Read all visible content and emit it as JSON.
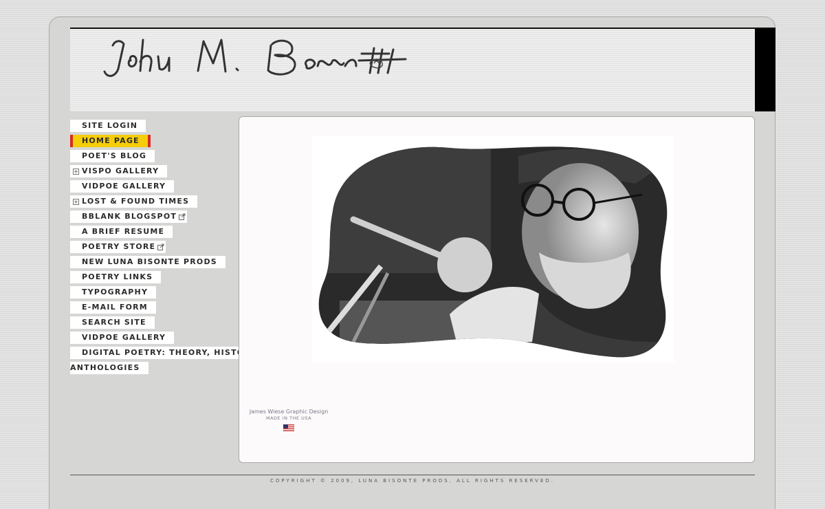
{
  "header": {
    "logo_text": "John M. Bennett"
  },
  "nav": {
    "items": [
      {
        "label": "SITE LOGIN"
      },
      {
        "label": "HOME PAGE"
      },
      {
        "label": "POET'S BLOG"
      },
      {
        "label": "VISPO GALLERY"
      },
      {
        "label": "VIDPOE GALLERY"
      },
      {
        "label": "LOST & FOUND TIMES"
      },
      {
        "label": "BBLANK BLOGSPOT"
      },
      {
        "label": "A BRIEF RESUME"
      },
      {
        "label": "POETRY STORE"
      },
      {
        "label": "NEW LUNA BISONTE PRODS"
      },
      {
        "label": "POETRY LINKS"
      },
      {
        "label": "TYPOGRAPHY"
      },
      {
        "label": "E-MAIL FORM"
      },
      {
        "label": "SEARCH SITE"
      },
      {
        "label": "VIDPOE GALLERY"
      },
      {
        "label": "DIGITAL POETRY: THEORY, HISTORY,"
      },
      {
        "label": "ANTHOLOGIES"
      }
    ],
    "active_color": "#f5cd0a",
    "active_border_color": "#d62b1f"
  },
  "credit": {
    "line1": "James Wiese Graphic Design",
    "line2": "MADE IN THE USA"
  },
  "footer": {
    "copyright": "COPYRIGHT © 2009, LUNA BISONTE PRODS. ALL RIGHTS RESERVED."
  },
  "icons": {
    "expand": "plus-box-icon",
    "external": "external-link-icon",
    "flag": "us-flag-icon"
  }
}
